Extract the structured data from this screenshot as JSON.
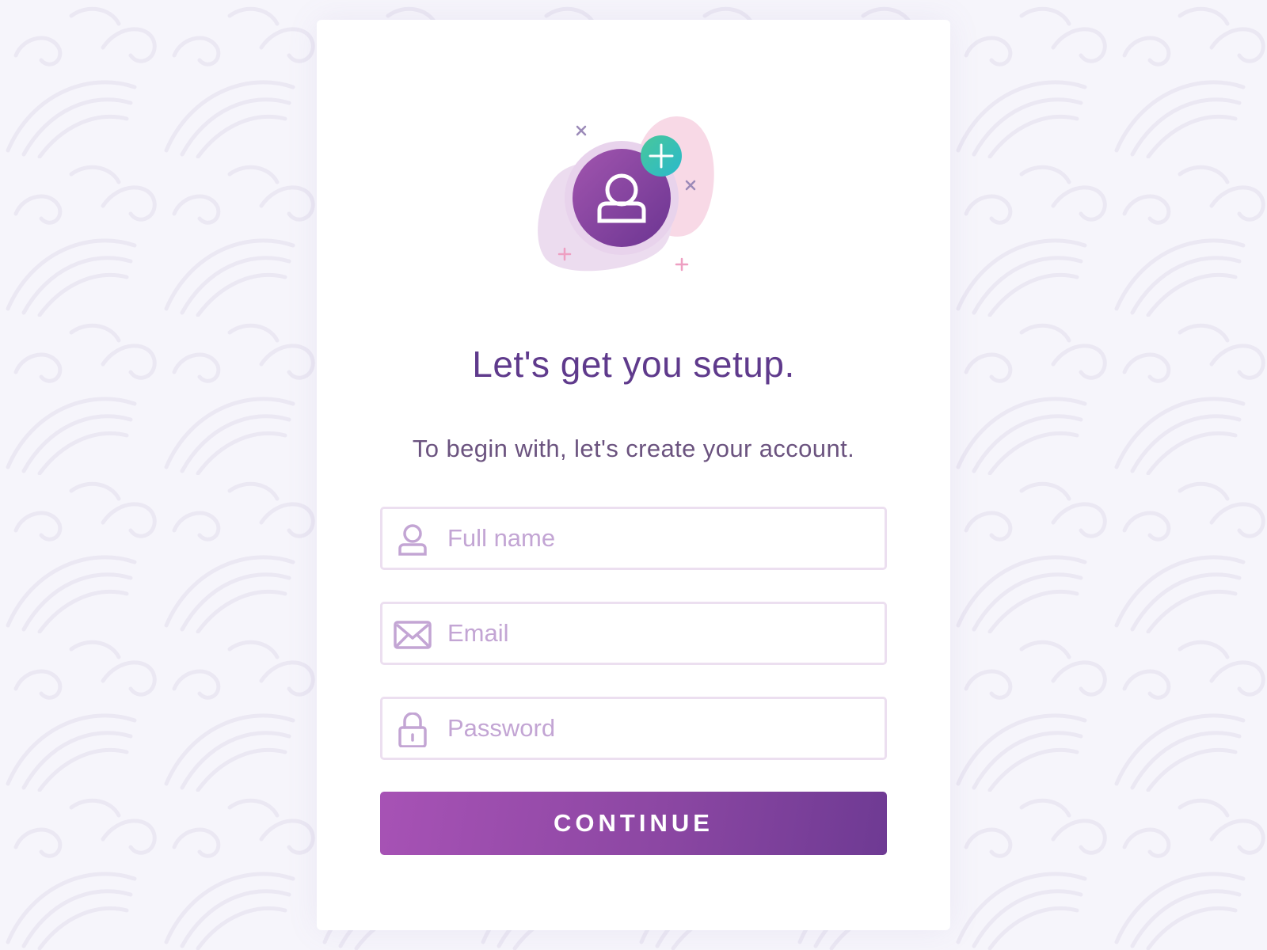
{
  "colors": {
    "background": "#f6f5fb",
    "card": "#ffffff",
    "title": "#5f3a8c",
    "subtitle": "#6b537f",
    "field_border": "#ecdff0",
    "placeholder": "#c3a5d4",
    "button_start": "#a752b5",
    "button_end": "#6e3a93",
    "button_text": "#ffffff",
    "badge": "#3cc0b3"
  },
  "illustration": {
    "icon": "add-user-icon",
    "badge_icon": "plus-icon"
  },
  "heading": {
    "title": "Let's get you setup.",
    "subtitle": "To begin with, let's create your account."
  },
  "form": {
    "full_name": {
      "placeholder": "Full name",
      "value": "",
      "icon": "user-icon"
    },
    "email": {
      "placeholder": "Email",
      "value": "",
      "icon": "envelope-icon"
    },
    "password": {
      "placeholder": "Password",
      "value": "",
      "icon": "lock-icon"
    },
    "continue_label": "CONTINUE"
  }
}
